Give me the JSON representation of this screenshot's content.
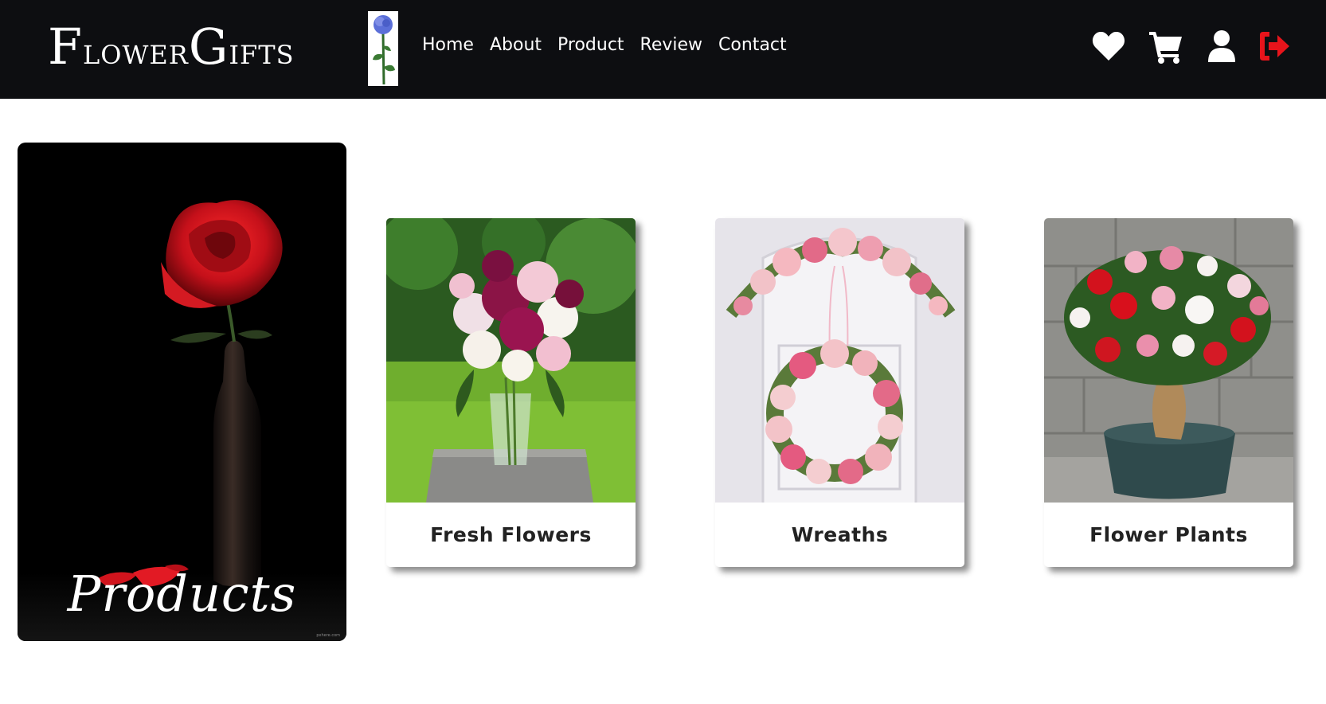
{
  "header": {
    "brand_first_letter": "F",
    "brand_part1": "lower",
    "brand_second_letter": "G",
    "brand_part2": "ifts",
    "nav": [
      "Home",
      "About",
      "Product",
      "Review",
      "Contact"
    ],
    "icons": [
      "heart-icon",
      "cart-icon",
      "user-icon",
      "logout-icon"
    ],
    "logout_color": "#e8141b"
  },
  "hero": {
    "title": "Products",
    "watermark": "pxhere.com"
  },
  "cards": [
    {
      "label": "Fresh Flowers",
      "image": "bouquet-in-vase"
    },
    {
      "label": "Wreaths",
      "image": "pink-wreath-on-door"
    },
    {
      "label": "Flower Plants",
      "image": "potted-flowering-plant"
    }
  ],
  "colors": {
    "topbar": "#0d0e11",
    "accent_logout": "#e8141b",
    "card_text": "#222222"
  }
}
